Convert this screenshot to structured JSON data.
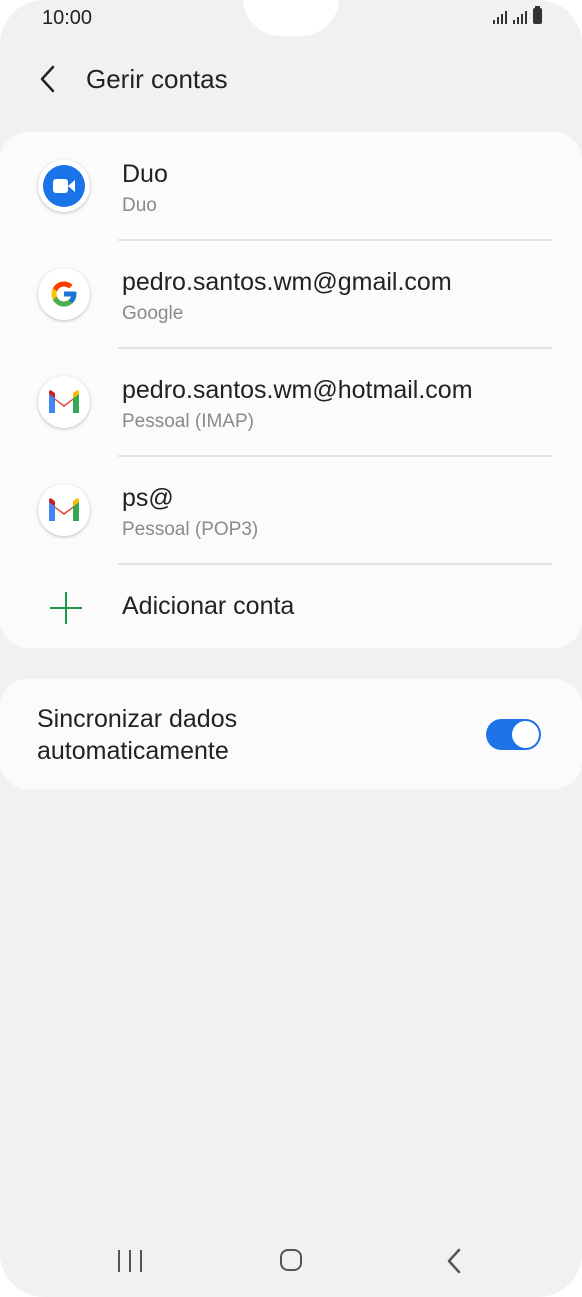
{
  "status_bar": {
    "time": "10:00"
  },
  "header": {
    "title": "Gerir contas"
  },
  "accounts": [
    {
      "name": "Duo",
      "type": "Duo",
      "icon": "duo-icon"
    },
    {
      "name": "pedro.santos.wm@gmail.com",
      "type": "Google",
      "icon": "google-icon"
    },
    {
      "name": "pedro.santos.wm@hotmail.com",
      "type": "Pessoal (IMAP)",
      "icon": "gmail-icon"
    },
    {
      "name": "ps@",
      "type": "Pessoal (POP3)",
      "icon": "gmail-icon"
    }
  ],
  "add_account": {
    "label": "Adicionar conta"
  },
  "sync": {
    "label_line1": "Sincronizar dados",
    "label_line2": "automaticamente",
    "enabled": true
  },
  "colors": {
    "accent": "#1e73e8",
    "add_green": "#1a9b4e",
    "background": "#f1f1f1",
    "card": "#fbfbfb"
  }
}
